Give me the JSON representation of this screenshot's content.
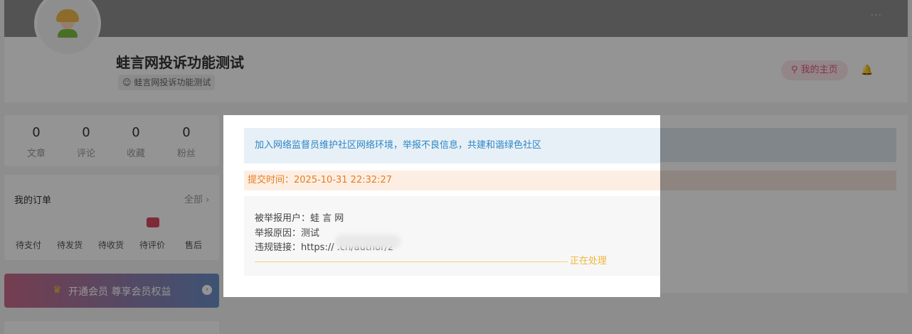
{
  "profile": {
    "name": "蛙言网投诉功能测试",
    "subtitle": "蛙言网投诉功能测试",
    "home_button": "我的主页",
    "more": "···"
  },
  "stats": [
    {
      "value": "0",
      "label": "文章"
    },
    {
      "value": "0",
      "label": "评论"
    },
    {
      "value": "0",
      "label": "收藏"
    },
    {
      "value": "0",
      "label": "粉丝"
    }
  ],
  "orders": {
    "title": "我的订单",
    "all": "全部 ›",
    "items": [
      "待支付",
      "待发货",
      "待收货",
      "待评价",
      "售后"
    ]
  },
  "vip": {
    "label": "开通会员 尊享会员权益"
  },
  "modal": {
    "notice": "加入网络监督员维护社区网络环境，举报不良信息，共建和谐绿色社区",
    "submit_time": "提交时间：2025-10-31 22:32:27",
    "reported_user": "被举报用户：蛙 言 网",
    "reason": "举报原因：测试",
    "link": "违规链接：https://                    .cn/author/2",
    "status": "正在处理"
  },
  "colors": {
    "notice_text": "#2b86c5",
    "time_text": "#e67e22",
    "status_text": "#f0b73a",
    "home_button": "#e05a7a"
  }
}
